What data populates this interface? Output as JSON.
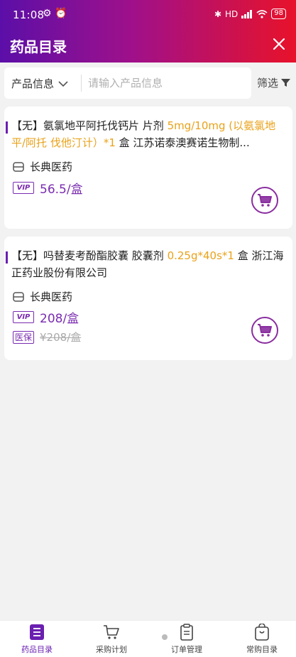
{
  "status_bar": {
    "time": "11:08",
    "left_icons": "⚙ ⏰",
    "network": "HD",
    "battery": "98"
  },
  "header": {
    "title": "药品目录"
  },
  "search": {
    "category": "产品信息",
    "placeholder": "请输入产品信息",
    "filter_label": "筛选"
  },
  "products": [
    {
      "prefix": "【无】",
      "name": "氨氯地平阿托伐钙片 片剂",
      "spec": "5mg/10mg (以氨氯地平/阿托 伐他汀计）*1",
      "unit_maker": " 盒 江苏诺泰澳赛诺生物制...",
      "supplier": "长典医药",
      "price_tag": "VIP",
      "price": "56.5/盒"
    },
    {
      "prefix": "【无】",
      "name": "吗替麦考酚酯胶囊 胶囊剂",
      "spec": "0.25g*40s*1",
      "unit_maker": " 盒 浙江海正药业股份有限公司",
      "supplier": "长典医药",
      "price_tag": "VIP",
      "price": "208/盒",
      "insurance_tag": "医保",
      "insurance_price": "¥208/盒"
    }
  ],
  "tabs": [
    {
      "label": "药品目录",
      "icon": "list-icon",
      "active": true
    },
    {
      "label": "采购计划",
      "icon": "cart-icon",
      "active": false
    },
    {
      "label": "订单管理",
      "icon": "clipboard-icon",
      "active": false
    },
    {
      "label": "常购目录",
      "icon": "bag-icon",
      "active": false
    }
  ],
  "colors": {
    "accent": "#7a2bb0",
    "spec": "#e9a21a",
    "header_start": "#5b0fa8",
    "header_end": "#e8122a"
  }
}
